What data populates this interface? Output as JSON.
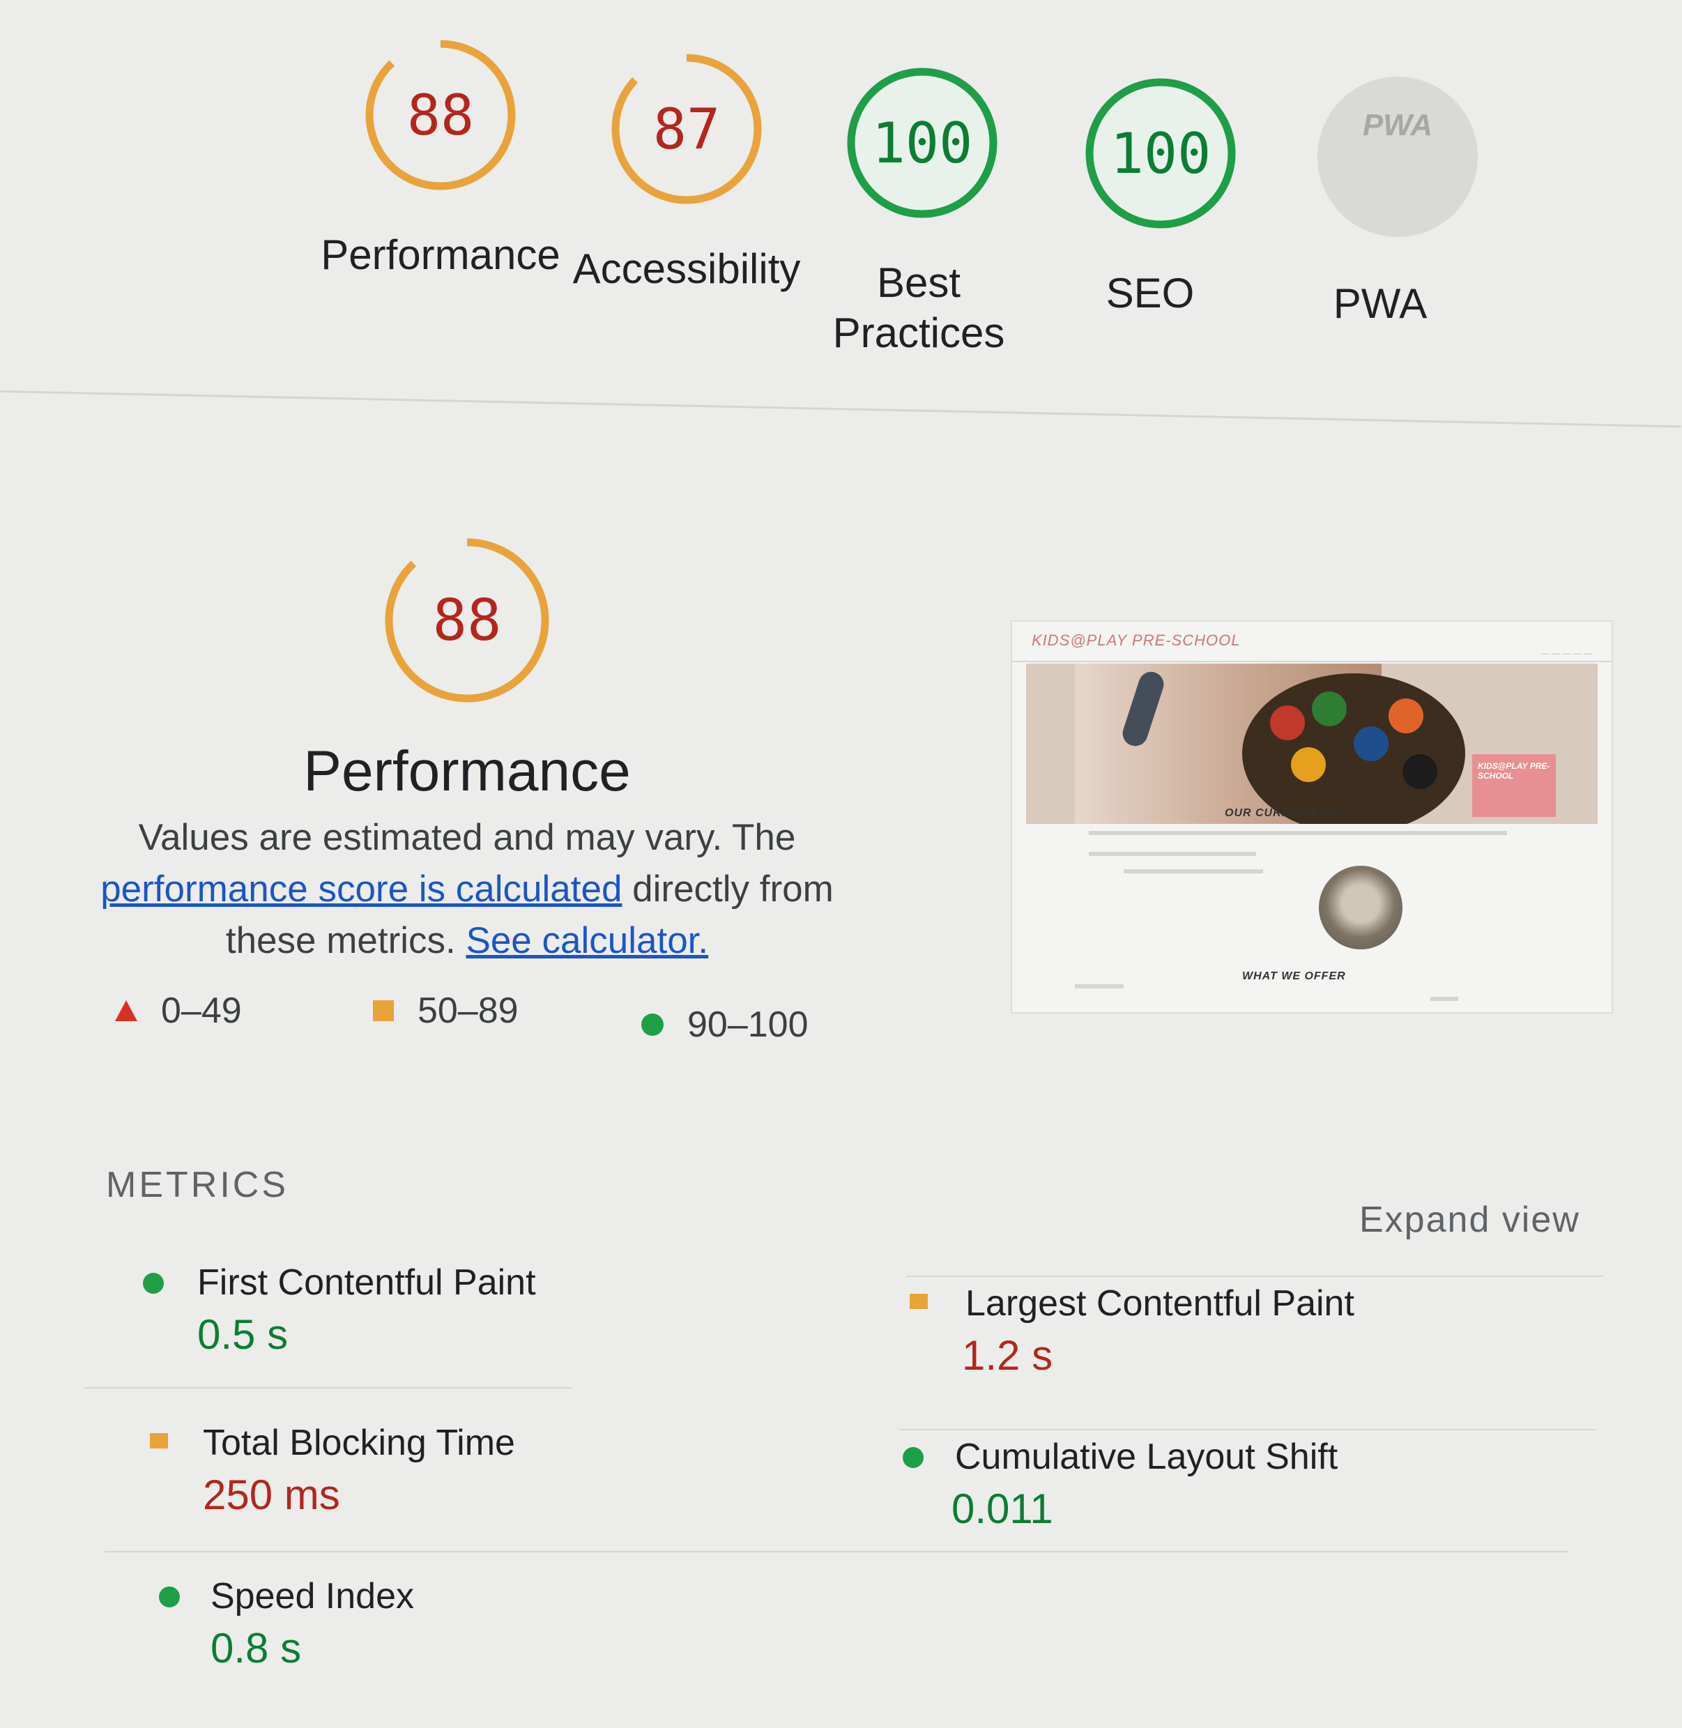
{
  "colors": {
    "average": "#e8a33b",
    "average_text": "#b3261e",
    "pass": "#1e9e47",
    "pass_text": "#0b7d34",
    "fail": "#d93025",
    "link": "#1a56c4",
    "pwa_gray": "#d9d9d7"
  },
  "categories": [
    {
      "label": "Performance",
      "score": "88",
      "status": "average"
    },
    {
      "label": "Accessibility",
      "score": "87",
      "status": "average"
    },
    {
      "label": "Best Practices",
      "score": "100",
      "status": "pass"
    },
    {
      "label": "SEO",
      "score": "100",
      "status": "pass"
    },
    {
      "label": "PWA",
      "badge_text": "PWA",
      "status": "na"
    }
  ],
  "performance": {
    "score": "88",
    "title": "Performance",
    "desc_before": "Values are estimated and may vary. The",
    "link_score": "performance score is calculated",
    "desc_middle": " directly from these metrics. ",
    "link_calculator": "See calculator."
  },
  "legend": [
    {
      "icon": "fail-triangle-icon",
      "range": "0–49"
    },
    {
      "icon": "average-square-icon",
      "range": "50–89"
    },
    {
      "icon": "pass-circle-icon",
      "range": "90–100"
    }
  ],
  "screenshot": {
    "site_title": "KIDS@PLAY PRE-SCHOOL",
    "section1": "OUR CURRICULUM",
    "section2": "WHAT WE OFFER",
    "badge": "KIDS@PLAY PRE-SCHOOL"
  },
  "metrics": {
    "heading": "METRICS",
    "expand_label": "Expand view",
    "items": [
      {
        "name": "First Contentful Paint",
        "value": "0.5 s",
        "status": "pass"
      },
      {
        "name": "Largest Contentful Paint",
        "value": "1.2 s",
        "status": "average"
      },
      {
        "name": "Total Blocking Time",
        "value": "250 ms",
        "status": "average"
      },
      {
        "name": "Cumulative Layout Shift",
        "value": "0.011",
        "status": "pass"
      },
      {
        "name": "Speed Index",
        "value": "0.8 s",
        "status": "pass"
      }
    ]
  }
}
